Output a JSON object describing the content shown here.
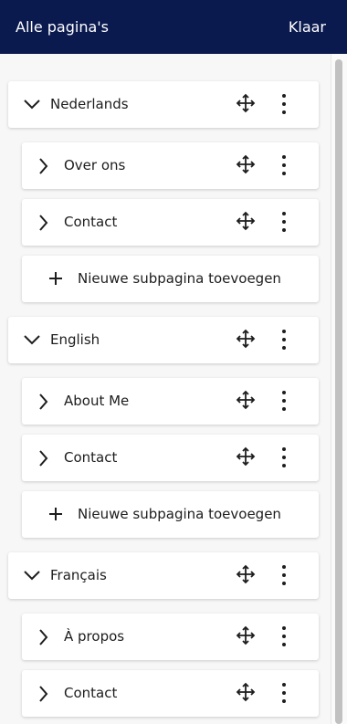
{
  "header": {
    "title": "Alle pagina's",
    "done_label": "Klaar",
    "background": "#0a1a4f"
  },
  "languages": [
    {
      "name": "Nederlands",
      "pages": [
        {
          "title": "Over ons"
        },
        {
          "title": "Contact"
        }
      ],
      "add_label": "Nieuwe subpagina toevoegen"
    },
    {
      "name": "English",
      "pages": [
        {
          "title": "About Me"
        },
        {
          "title": "Contact"
        }
      ],
      "add_label": "Nieuwe subpagina toevoegen"
    },
    {
      "name": "Français",
      "pages": [
        {
          "title": "À propos"
        },
        {
          "title": "Contact"
        }
      ]
    }
  ],
  "icons": {
    "expand": "chevron-down-icon",
    "collapse": "chevron-right-icon",
    "drag": "move-icon",
    "menu": "more-vertical-icon",
    "add": "plus-icon"
  }
}
